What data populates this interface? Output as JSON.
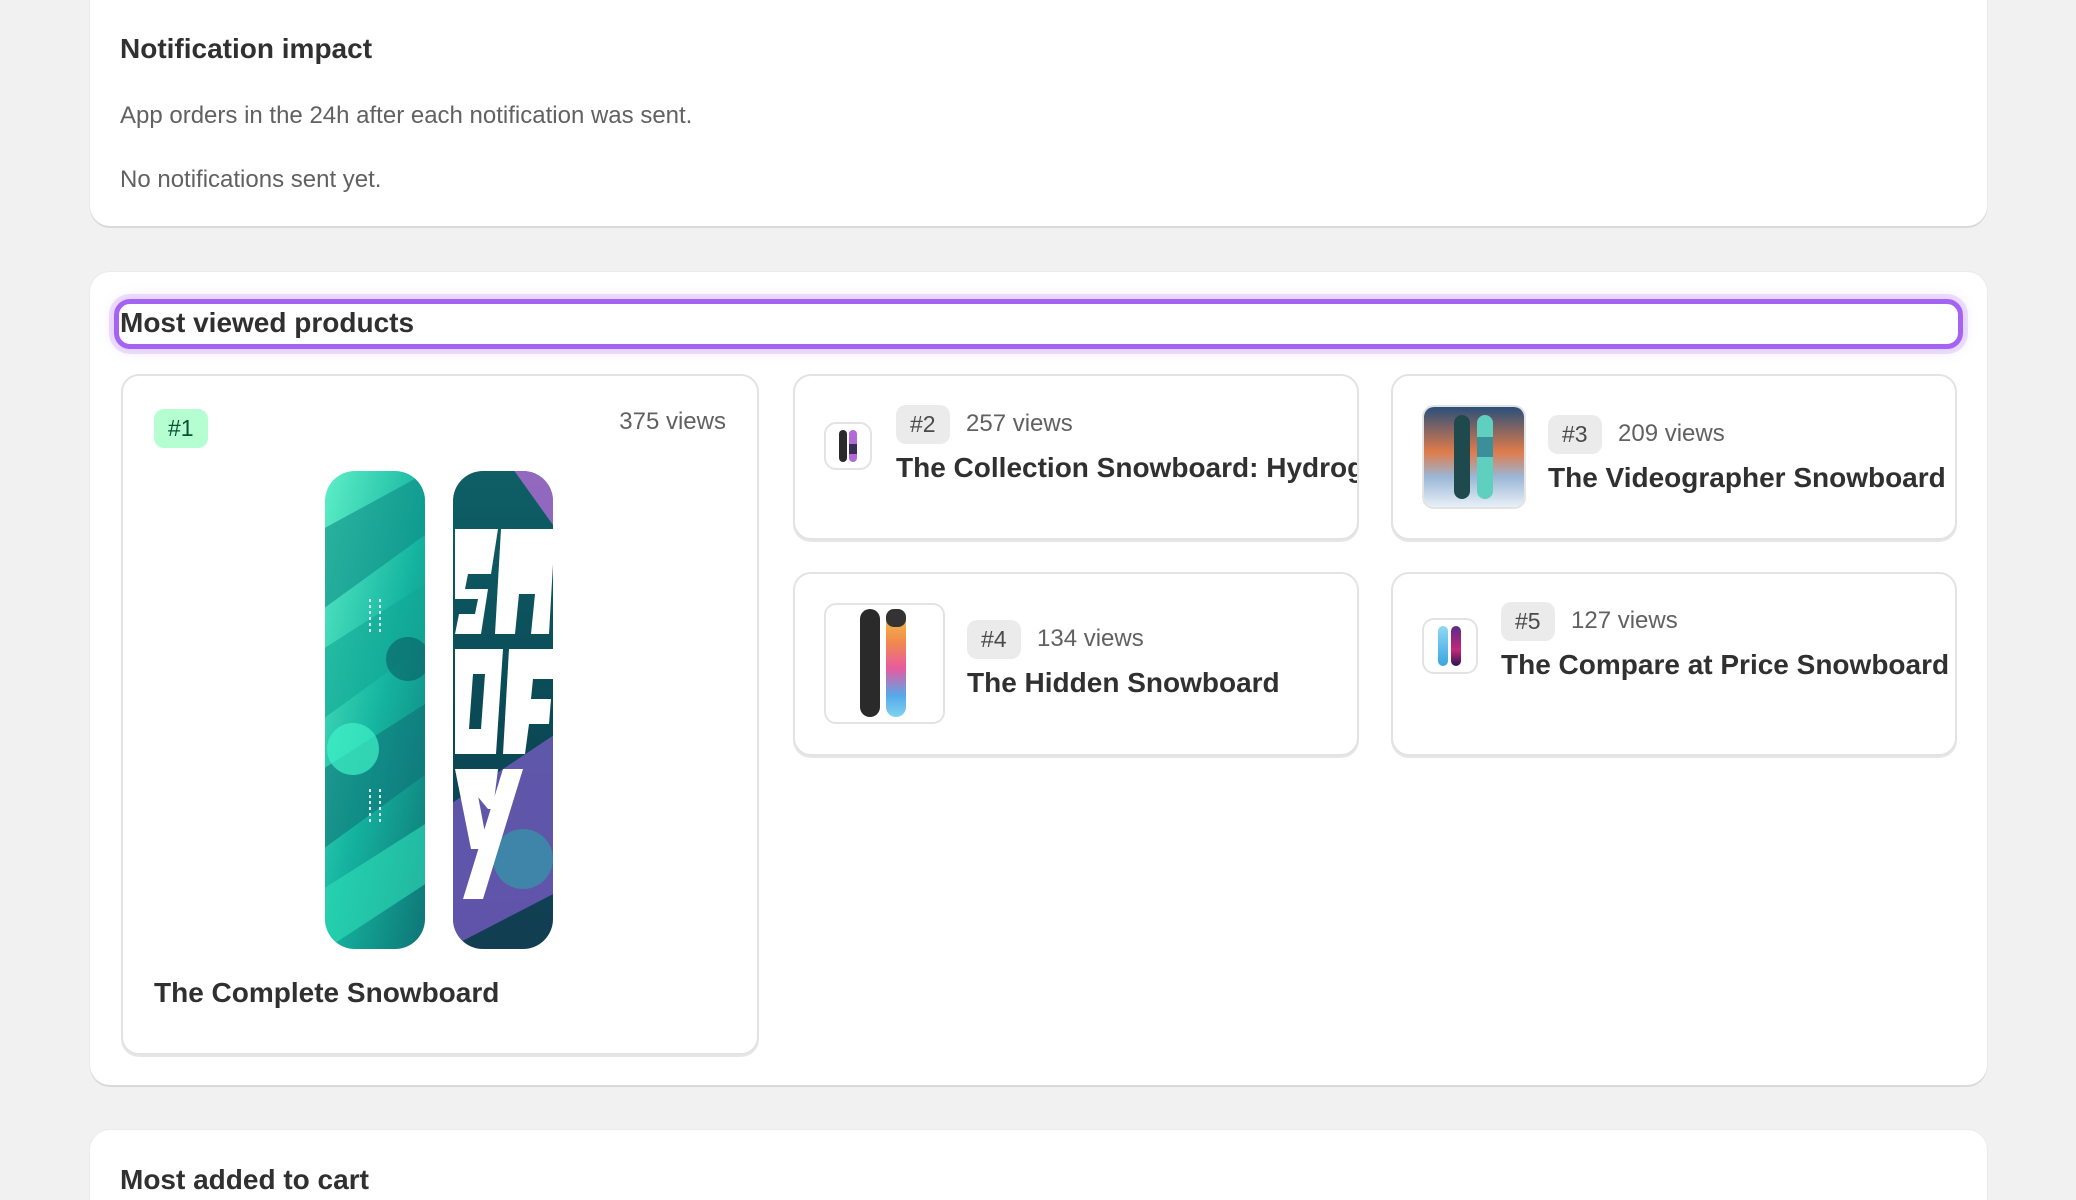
{
  "notification_impact": {
    "title": "Notification impact",
    "description": "App orders in the 24h after each notification was sent.",
    "empty_state": "No notifications sent yet."
  },
  "most_viewed": {
    "title": "Most viewed products",
    "products": [
      {
        "rank": "#1",
        "views": "375 views",
        "name": "The Complete Snowboard"
      },
      {
        "rank": "#2",
        "views": "257 views",
        "name": "The Collection Snowboard: Hydrogen"
      },
      {
        "rank": "#3",
        "views": "209 views",
        "name": "The Videographer Snowboard"
      },
      {
        "rank": "#4",
        "views": "134 views",
        "name": "The Hidden Snowboard"
      },
      {
        "rank": "#5",
        "views": "127 views",
        "name": "The Compare at Price Snowboard"
      }
    ]
  },
  "most_added": {
    "title": "Most added to cart"
  },
  "colors": {
    "highlight": "#a463f2",
    "rank_first_bg": "#b4fed2",
    "rank_bg": "#ebebeb"
  }
}
